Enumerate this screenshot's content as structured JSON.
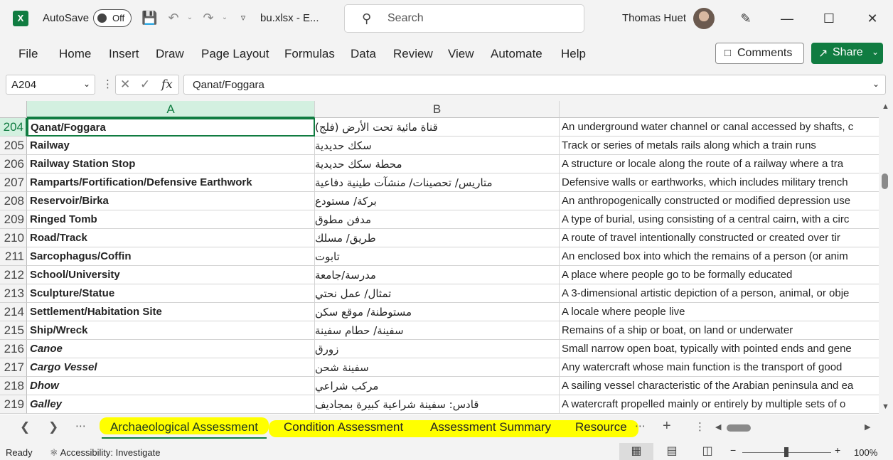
{
  "titlebar": {
    "app_logo": "X",
    "autosave_label": "AutoSave",
    "autosave_state": "Off",
    "filename": "bu.xlsx  -  E...",
    "search_placeholder": "Search",
    "user_name": "Thomas Huet"
  },
  "menu": [
    "File",
    "Home",
    "Insert",
    "Draw",
    "Page Layout",
    "Formulas",
    "Data",
    "Review",
    "View",
    "Automate",
    "Help"
  ],
  "actions": {
    "comments": "Comments",
    "share": "Share"
  },
  "formula_bar": {
    "name_box": "A204",
    "fx": "fx",
    "formula": "Qanat/Foggara"
  },
  "columns": [
    "A",
    "B"
  ],
  "rows": [
    {
      "num": "204",
      "a": "Qanat/Foggara",
      "b": "قناة مائية تحت الأرض (فلج)",
      "c": "An underground water channel or canal accessed by shafts, c",
      "italic": false
    },
    {
      "num": "205",
      "a": "Railway",
      "b": "سكك حديدية",
      "c": "Track or series of metals rails along which a train runs",
      "italic": false
    },
    {
      "num": "206",
      "a": "Railway Station Stop",
      "b": "محطة سكك حديدية",
      "c": "A structure or locale along the route of a railway where a tra",
      "italic": false
    },
    {
      "num": "207",
      "a": "Ramparts/Fortification/Defensive Earthwork",
      "b": "متاريس/ تحصينات/ منشآت طينية دفاعية",
      "c": "Defensive walls or earthworks, which includes military trench",
      "italic": false
    },
    {
      "num": "208",
      "a": "Reservoir/Birka",
      "b": "بركة/ مستودع",
      "c": "An anthropogenically constructed or modified depression use",
      "italic": false
    },
    {
      "num": "209",
      "a": "Ringed Tomb",
      "b": "مدفن مطوق",
      "c": "A type of burial, using consisting of a central cairn, with a circ",
      "italic": false
    },
    {
      "num": "210",
      "a": "Road/Track",
      "b": "طريق/ مسلك",
      "c": "A route of travel intentionally constructed or created over tir",
      "italic": false
    },
    {
      "num": "211",
      "a": "Sarcophagus/Coffin",
      "b": "تابوت",
      "c": "An enclosed box into which the remains of a person (or anim",
      "italic": false
    },
    {
      "num": "212",
      "a": "School/University",
      "b": "مدرسة/جامعة",
      "c": "A place where people go to be formally educated",
      "italic": false
    },
    {
      "num": "213",
      "a": "Sculpture/Statue",
      "b": "تمثال/ عمل نحتي",
      "c": "A 3-dimensional artistic depiction of a person, animal, or obje",
      "italic": false
    },
    {
      "num": "214",
      "a": "Settlement/Habitation Site",
      "b": "مستوطنة/ موقع سكن",
      "c": "A locale where people live",
      "italic": false
    },
    {
      "num": "215",
      "a": "Ship/Wreck",
      "b": "سفينة/ حطام سفينة",
      "c": "Remains of a ship or boat, on land or underwater",
      "italic": false
    },
    {
      "num": "216",
      "a": "Canoe",
      "b": "زورق",
      "c": "Small narrow open boat, typically with pointed ends and gene",
      "italic": true
    },
    {
      "num": "217",
      "a": "Cargo Vessel",
      "b": "سفينة شحن",
      "c": "Any watercraft whose main function is the transport of good",
      "italic": true
    },
    {
      "num": "218",
      "a": "Dhow",
      "b": "مركب شراعي",
      "c": "A sailing vessel characteristic of the Arabian peninsula and ea",
      "italic": true
    },
    {
      "num": "219",
      "a": "Galley",
      "b": "قادس: سفينة شراعية كبيرة بمجاديف",
      "c": "A watercraft propelled mainly or entirely by multiple sets of o",
      "italic": true
    }
  ],
  "sheets": [
    "Archaeological Assessment",
    "Condition Assessment",
    "Assessment Summary",
    "Resource"
  ],
  "status": {
    "ready": "Ready",
    "accessibility": "Accessibility: Investigate",
    "zoom": "100%"
  },
  "colors": {
    "accent": "#107c41",
    "highlight": "#ffff00"
  }
}
